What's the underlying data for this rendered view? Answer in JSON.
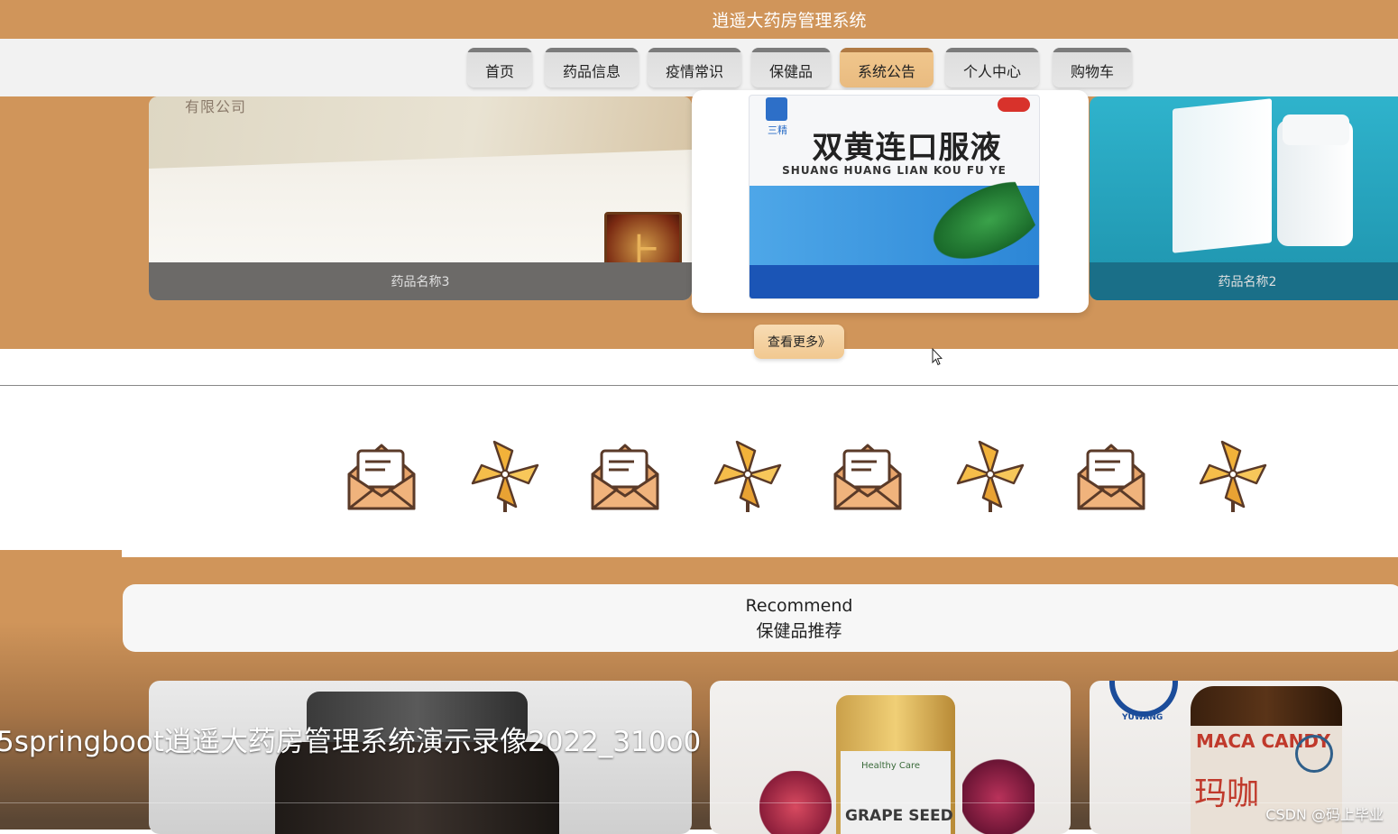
{
  "header": {
    "title": "逍遥大药房管理系统"
  },
  "nav": {
    "items": [
      {
        "label": "首页"
      },
      {
        "label": "药品信息"
      },
      {
        "label": "疫情常识"
      },
      {
        "label": "保健品"
      },
      {
        "label": "系统公告",
        "active": true
      },
      {
        "label": "个人中心"
      },
      {
        "label": "购物车"
      }
    ]
  },
  "carousel": {
    "card1": {
      "caption": "药品名称3",
      "company": "有限公司",
      "seal": "上"
    },
    "card2": {
      "title": "双黄连口服液",
      "pinyin": "SHUANG HUANG LIAN KOU FU YE",
      "logo_text": "三精"
    },
    "card3": {
      "caption": "药品名称2"
    },
    "more_label": "查看更多》"
  },
  "icon_row": [
    "envelope-icon",
    "pinwheel-icon",
    "envelope-icon",
    "pinwheel-icon",
    "envelope-icon",
    "pinwheel-icon",
    "envelope-icon",
    "pinwheel-icon"
  ],
  "recommend": {
    "title_en": "Recommend",
    "title_cn": "保健品推荐"
  },
  "products": {
    "p2": {
      "brand": "Healthy Care",
      "name": "GRAPE SEED"
    },
    "p3": {
      "logo": "YUWANG",
      "name": "MACA CANDY",
      "cn": "玛咖"
    }
  },
  "overlay": {
    "video_title": "5springboot逍遥大药房管理系统演示录像2022_310o0",
    "watermark": "CSDN @码上毕业"
  },
  "colors": {
    "brand": "#d0955a",
    "active_tab": "#f0c68c",
    "nav_bg": "#f2f2f2"
  }
}
